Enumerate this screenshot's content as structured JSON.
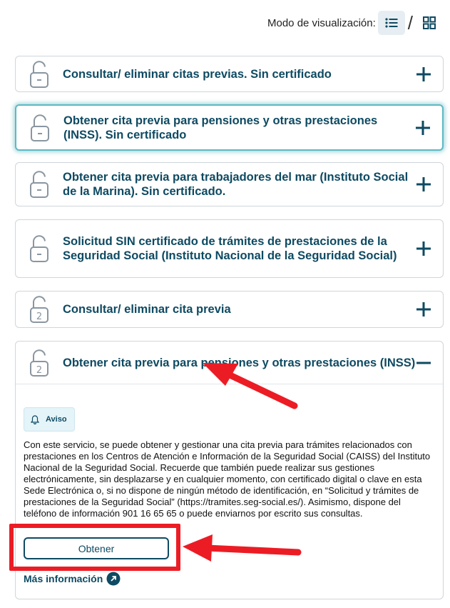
{
  "view_mode": {
    "label": "Modo de visualización:",
    "list_icon": "list-icon",
    "grid_icon": "grid-icon",
    "separator": "/"
  },
  "services": [
    {
      "title": "Consultar/ eliminar citas previas. Sin certificado",
      "icon": "lock-open-dash-icon",
      "expanded": false
    },
    {
      "title": "Obtener cita previa para pensiones y otras prestaciones (INSS). Sin certificado",
      "icon": "lock-open-dash-icon",
      "expanded": false
    },
    {
      "title": "Obtener cita previa para trabajadores del mar (Instituto Social de la Marina). Sin certificado.",
      "icon": "lock-open-dash-icon",
      "expanded": false
    },
    {
      "title": "Solicitud SIN certificado de trámites de prestaciones de la Seguridad Social (Instituto Nacional de la Seguridad Social)",
      "icon": "lock-open-dash-icon",
      "expanded": false
    },
    {
      "title": "Consultar/ eliminar cita previa",
      "icon": "lock-open-2-icon",
      "expanded": false
    },
    {
      "title": "Obtener cita previa para pensiones y otras prestaciones (INSS)",
      "icon": "lock-open-2-icon",
      "expanded": true
    }
  ],
  "expanded_panel": {
    "aviso_label": "Aviso",
    "body_text": "Con este servicio, se puede obtener y gestionar una cita previa para trámites relacionados con prestaciones en los Centros de Atención e Información de la Seguridad Social (CAISS) del Instituto Nacional de la Seguridad Social. Recuerde que también puede realizar sus gestiones electrónicamente, sin desplazarse y en cualquier momento, con certificado digital o clave en esta Sede Electrónica o, si no dispone de ningún método de identificación, en “Solicitud y trámites de prestaciones de la Seguridad Social” (https://tramites.seg-social.es/). Asimismo, dispone del teléfono de información 901 16 65 65 o puede enviarnos por escrito sus consultas.",
    "button_label": "Obtener",
    "more_info_label": "Más información"
  },
  "colors": {
    "primary": "#0e4a62",
    "focus_ring": "#5fb8c2",
    "annotation_red": "#ec1c24",
    "aviso_bg": "#e4f4f9"
  }
}
